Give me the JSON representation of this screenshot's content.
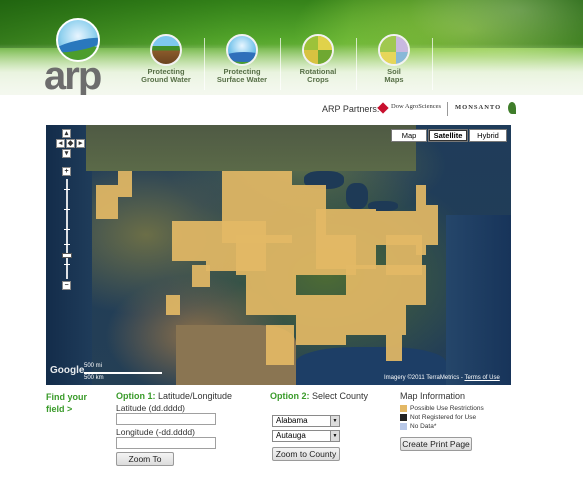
{
  "brand": {
    "logo_text": "arp"
  },
  "nav": [
    {
      "line1": "Protecting",
      "line2": "Ground Water"
    },
    {
      "line1": "Protecting",
      "line2": "Surface Water"
    },
    {
      "line1": "Rotational",
      "line2": "Crops"
    },
    {
      "line1": "Soil",
      "line2": "Maps"
    }
  ],
  "partners": {
    "label": "ARP Partners:",
    "dow": "Dow AgroSciences",
    "monsanto": "MONSANTO"
  },
  "map": {
    "types": [
      "Map",
      "Satellite",
      "Hybrid"
    ],
    "active_type": "Satellite",
    "scale_mi": "500 mi",
    "scale_km": "500 km",
    "logo": "Google",
    "imagery": "Imagery ©2011 TerraMetrics - ",
    "terms": "Terms of Use",
    "colors": {
      "possible": "#e3b865",
      "not_registered": "#222222",
      "no_data": "#b8c8e8"
    }
  },
  "find": {
    "line1": "Find your",
    "line2": "field >"
  },
  "option1": {
    "prefix": "Option 1:",
    "title": " Latitude/Longitude",
    "lat_label": "Latitude (dd.dddd)",
    "lat_value": "",
    "lon_label": "Longitude (-dd.dddd)",
    "lon_value": "",
    "button": "Zoom To"
  },
  "option2": {
    "prefix": "Option 2:",
    "title": " Select County",
    "state": "Alabama",
    "county": "Autauga",
    "button": "Zoom to County"
  },
  "info": {
    "title": "Map Information",
    "legend": [
      "Possible Use Restrictions",
      "Not Registered for Use",
      "No Data*"
    ],
    "print_button": "Create Print Page"
  }
}
